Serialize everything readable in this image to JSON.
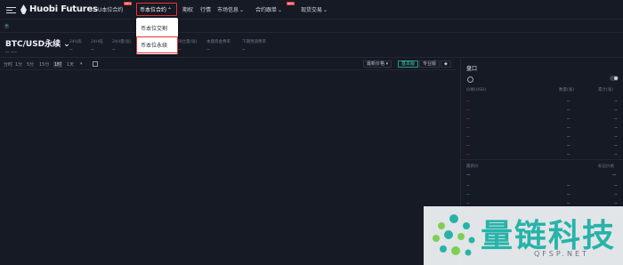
{
  "nav": {
    "logo_text": "Huobi Futures",
    "items": [
      {
        "label": "U本位合约",
        "has_new": true
      },
      {
        "label": "币本位合约",
        "active": true
      },
      {
        "label": "期权"
      },
      {
        "label": "行情"
      },
      {
        "label": "市场信息"
      },
      {
        "label": "合约跟单",
        "has_new": true
      },
      {
        "label": "现货交易"
      }
    ],
    "new_tag": "NEW"
  },
  "dropdown": {
    "items": [
      {
        "label": "币本位交割"
      },
      {
        "label": "币本位永续",
        "selected": true
      }
    ]
  },
  "subbar": {
    "add_label": "+"
  },
  "ticker": {
    "symbol": "BTC/USD永续",
    "price_placeholder": "-- ---",
    "stats": [
      {
        "label": "24H高",
        "value": "--"
      },
      {
        "label": "24H低",
        "value": "--"
      },
      {
        "label": "24H量(张)",
        "value": "--"
      },
      {
        "label": "持仓量(张)",
        "value": "--"
      },
      {
        "label": "本期资金费率",
        "value": "--"
      },
      {
        "label": "下期预测费率",
        "value": "--"
      }
    ]
  },
  "chart_toolbar": {
    "timeframes": [
      "分时",
      "1分",
      "5分",
      "15分",
      "1时",
      "1天"
    ],
    "active_timeframe": "1时",
    "more": "▾",
    "price_mode": "最新价格 ▾",
    "basic": "基本版",
    "pro": "专业版",
    "extra": "◆"
  },
  "orderbook": {
    "title": "盘口",
    "columns": [
      "价格(USD)",
      "数量(张)",
      "累计(张)"
    ],
    "asks": [
      "--",
      "--",
      "--",
      "--",
      "--",
      "--",
      "--"
    ],
    "bids": [
      "--",
      "--",
      "--",
      "--"
    ],
    "latest_label": "最新价",
    "index_label": "标记价格",
    "latest_value": "--",
    "index_value": "--"
  },
  "watermark": {
    "text": "量链科技",
    "sub": "QFSP.NET"
  },
  "colors": {
    "background": "#161a24",
    "accent_red": "#e53333",
    "ask": "#e0525a",
    "bid": "#3fbf8f",
    "brand_teal": "#27b3a9"
  }
}
